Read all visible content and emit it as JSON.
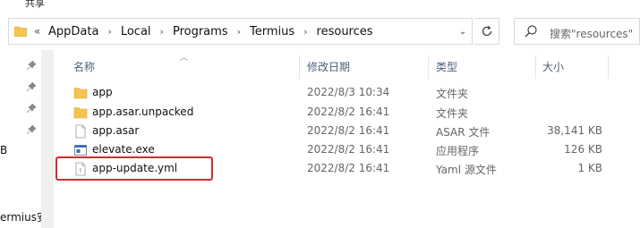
{
  "ribbon": {
    "tab_label": "共享"
  },
  "address_bar": {
    "back_chevron": "«",
    "crumbs": [
      "AppData",
      "Local",
      "Programs",
      "Termius",
      "resources"
    ],
    "dropdown_icon": "chevron-down-icon",
    "refresh_icon": "refresh-icon"
  },
  "search": {
    "placeholder": "搜索\"resources\"",
    "icon": "search-icon"
  },
  "nav_pane": {
    "fragment_b": "B",
    "fragment_termius": "ermius安"
  },
  "columns": {
    "name": "名称",
    "date": "修改日期",
    "type": "类型",
    "size": "大小"
  },
  "files": [
    {
      "name": "app",
      "date": "2022/8/3 10:34",
      "type": "文件夹",
      "size": "",
      "icon": "folder-icon"
    },
    {
      "name": "app.asar.unpacked",
      "date": "2022/8/2 16:41",
      "type": "文件夹",
      "size": "",
      "icon": "folder-icon"
    },
    {
      "name": "app.asar",
      "date": "2022/8/2 16:41",
      "type": "ASAR 文件",
      "size": "38,141 KB",
      "icon": "file-icon"
    },
    {
      "name": "elevate.exe",
      "date": "2022/8/2 16:41",
      "type": "应用程序",
      "size": "126 KB",
      "icon": "exe-icon"
    },
    {
      "name": "app-update.yml",
      "date": "2022/8/2 16:41",
      "type": "Yaml 源文件",
      "size": "1 KB",
      "icon": "yaml-file-icon"
    }
  ],
  "colors": {
    "highlight": "#d42a2a",
    "folder": "#f5c451",
    "header_text": "#4c607a"
  }
}
